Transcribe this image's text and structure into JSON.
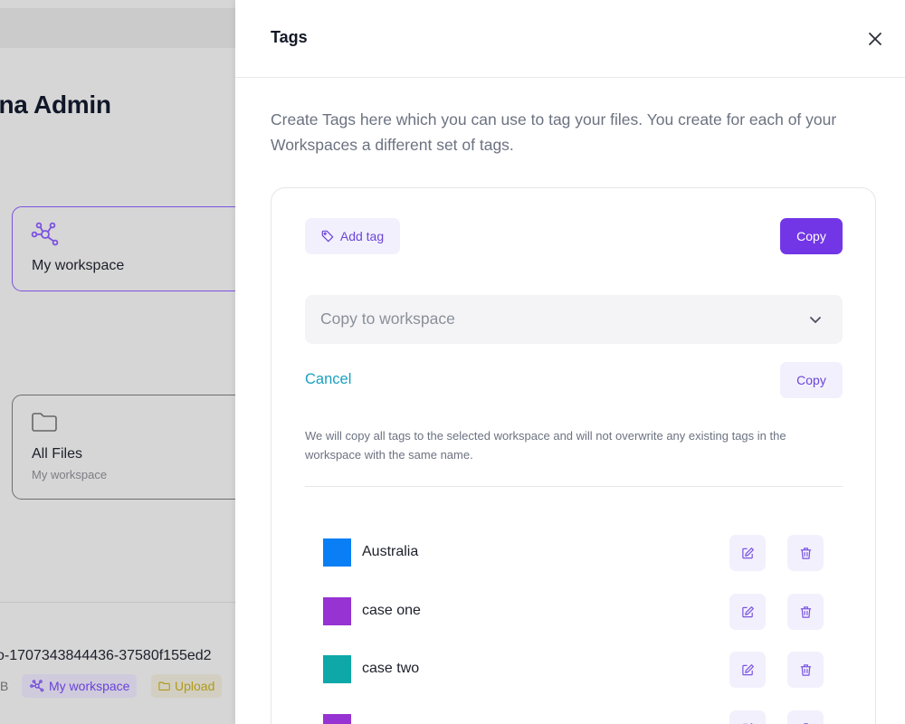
{
  "background": {
    "title": "zuna Admin",
    "workspace_card": {
      "label": "My workspace",
      "icon": "network-icon"
    },
    "files_card": {
      "label": "All Files",
      "sublabel": "My workspace",
      "icon": "folder-icon"
    },
    "file_row": {
      "name": "o-1707343844436-37580f155ed2",
      "size": "B",
      "workspace_chip": "My workspace",
      "upload_chip": "Upload"
    }
  },
  "drawer": {
    "title": "Tags",
    "description": "Create Tags here which you can use to tag your files. You create for each of your Workspaces a different set of tags.",
    "add_tag_label": "Add tag",
    "copy_label": "Copy",
    "select_placeholder": "Copy to workspace",
    "cancel_label": "Cancel",
    "copy_confirm_label": "Copy",
    "note": "We will copy all tags to the selected workspace and will not overwrite any existing tags in the workspace with the same name.",
    "tags": [
      {
        "name": "Australia",
        "color": "#0a7ff5"
      },
      {
        "name": "case one",
        "color": "#9733d2"
      },
      {
        "name": "case two",
        "color": "#0ea8a8"
      },
      {
        "name": "",
        "color": "#9733d2"
      }
    ]
  },
  "colors": {
    "accent": "#7236e6",
    "accent_soft": "#f3f0fd",
    "link": "#1aa0c0"
  }
}
